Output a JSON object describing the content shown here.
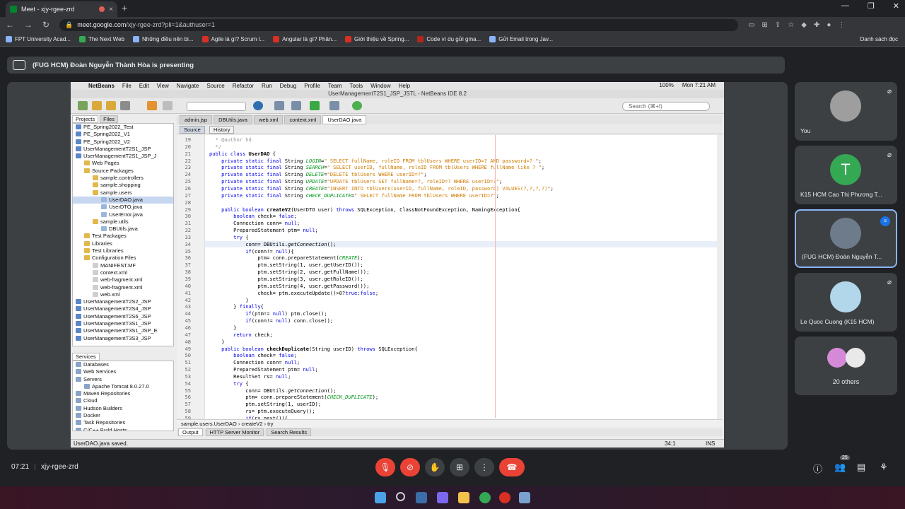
{
  "browser": {
    "tab_title": "Meet - xjy-rgee-zrd",
    "tab_close": "×",
    "new_tab": "+",
    "window_controls": [
      "—",
      "❐",
      "✕"
    ],
    "url_host": "meet.google.com",
    "url_path": "/xjy-rgee-zrd?pli=1&authuser=1",
    "bookmarks": [
      "FPT University Acad...",
      "The Next Web",
      "Những điều nên bi...",
      "Agile là gì? Scrum l...",
      "Angular là gì? Phân...",
      "Giới thiệu về Spring...",
      "Code ví dụ gửi gma...",
      "Gửi Email trong Jav..."
    ],
    "bookmarks_right": "Danh sách đọc"
  },
  "meet": {
    "presenting_text": "(FUG HCM) Đoàn Nguyễn Thành Hòa is presenting",
    "time": "07:21",
    "separator": "|",
    "meeting_code": "xjy-rgee-zrd",
    "people_badge": "25",
    "participants": [
      {
        "name": "You",
        "avatar_color": "#9e9e9e"
      },
      {
        "name": "K15 HCM Cao Thị Phương T...",
        "initial": "T",
        "avatar_color": "#34a853"
      },
      {
        "name": "(FUG HCM) Đoàn Nguyễn T...",
        "avatar_color": "#6d7b8a"
      },
      {
        "name": "Le Quoc Cuong (K15 HCM)",
        "avatar_color": "#b3d7ea"
      },
      {
        "name": "20 others"
      }
    ]
  },
  "netbeans": {
    "menu": [
      "NetBeans",
      "File",
      "Edit",
      "View",
      "Navigate",
      "Source",
      "Refactor",
      "Run",
      "Debug",
      "Profile",
      "Team",
      "Tools",
      "Window",
      "Help"
    ],
    "menu_right": [
      "100%",
      "Mon 7:21 AM"
    ],
    "title": "UserManagementT2S1_JSP_JSTL - NetBeans IDE 8.2",
    "search_placeholder": "Search (⌘+I)",
    "project_tabs": [
      "Projects",
      "Files"
    ],
    "project_tree": [
      {
        "label": "PE_Spring2022_Test",
        "indent": 0,
        "icon": "#5b87c8"
      },
      {
        "label": "PE_Spring2022_V1",
        "indent": 0,
        "icon": "#5b87c8"
      },
      {
        "label": "PE_Spring2022_V2",
        "indent": 0,
        "icon": "#5b87c8"
      },
      {
        "label": "UserManagementT2S1_JSP",
        "indent": 0,
        "icon": "#5b87c8"
      },
      {
        "label": "UserManagementT2S1_JSP_J",
        "indent": 0,
        "icon": "#5b87c8"
      },
      {
        "label": "Web Pages",
        "indent": 1,
        "icon": "#e2b84a"
      },
      {
        "label": "Source Packages",
        "indent": 1,
        "icon": "#e2b84a"
      },
      {
        "label": "sample.controllers",
        "indent": 2,
        "icon": "#e2b84a"
      },
      {
        "label": "sample.shopping",
        "indent": 2,
        "icon": "#e2b84a"
      },
      {
        "label": "sample.users",
        "indent": 2,
        "icon": "#e2b84a"
      },
      {
        "label": "UserDAO.java",
        "indent": 3,
        "icon": "#9bb7de",
        "selected": true
      },
      {
        "label": "UserDTO.java",
        "indent": 3,
        "icon": "#9bb7de"
      },
      {
        "label": "UserError.java",
        "indent": 3,
        "icon": "#9bb7de"
      },
      {
        "label": "sample.utils",
        "indent": 2,
        "icon": "#e2b84a"
      },
      {
        "label": "DBUtils.java",
        "indent": 3,
        "icon": "#9bb7de"
      },
      {
        "label": "Test Packages",
        "indent": 1,
        "icon": "#e2b84a"
      },
      {
        "label": "Libraries",
        "indent": 1,
        "icon": "#e2b84a"
      },
      {
        "label": "Test Libraries",
        "indent": 1,
        "icon": "#e2b84a"
      },
      {
        "label": "Configuration Files",
        "indent": 1,
        "icon": "#e2b84a"
      },
      {
        "label": "MANIFEST.MF",
        "indent": 2,
        "icon": "#cfcfcf"
      },
      {
        "label": "context.xml",
        "indent": 2,
        "icon": "#cfcfcf"
      },
      {
        "label": "web-fragment.xml",
        "indent": 2,
        "icon": "#cfcfcf"
      },
      {
        "label": "web-fragment.xml",
        "indent": 2,
        "icon": "#cfcfcf"
      },
      {
        "label": "web.xml",
        "indent": 2,
        "icon": "#cfcfcf"
      },
      {
        "label": "UserManagementT2S2_JSP",
        "indent": 0,
        "icon": "#5b87c8"
      },
      {
        "label": "UserManagementT2S4_JSP",
        "indent": 0,
        "icon": "#5b87c8"
      },
      {
        "label": "UserManagementT2S6_JSP",
        "indent": 0,
        "icon": "#5b87c8"
      },
      {
        "label": "UserManagementT3S1_JSP",
        "indent": 0,
        "icon": "#5b87c8"
      },
      {
        "label": "UserManagementT3S1_JSP_E",
        "indent": 0,
        "icon": "#5b87c8"
      },
      {
        "label": "UserManagementT3S3_JSP",
        "indent": 0,
        "icon": "#5b87c8"
      }
    ],
    "services_tab": "Services",
    "services_tree": [
      {
        "label": "Databases",
        "indent": 0
      },
      {
        "label": "Web Services",
        "indent": 0
      },
      {
        "label": "Servers",
        "indent": 0
      },
      {
        "label": "Apache Tomcat 8.0.27.0",
        "indent": 1
      },
      {
        "label": "Maven Repositories",
        "indent": 0
      },
      {
        "label": "Cloud",
        "indent": 0
      },
      {
        "label": "Hudson Builders",
        "indent": 0
      },
      {
        "label": "Docker",
        "indent": 0
      },
      {
        "label": "Task Repositories",
        "indent": 0
      },
      {
        "label": "C/C++ Build Hosts",
        "indent": 0
      }
    ],
    "editor_tabs": [
      "admin.jsp",
      "DBUtils.java",
      "web.xml",
      "context.xml",
      "UserDAO.java"
    ],
    "active_tab": "UserDAO.java",
    "source_btn": "Source",
    "history_btn": "History",
    "code_lines": [
      {
        "n": "19",
        "html": "  <span class=\"cm\">* @author hd</span>"
      },
      {
        "n": "20",
        "html": "  <span class=\"cm\">*/</span>"
      },
      {
        "n": "21",
        "html": "<span class=\"kw\">public class</span> <b>UserDAO</b> {"
      },
      {
        "n": "22",
        "html": "    <span class=\"kw\">private static final</span> String <span class=\"fld\">LOGIN</span>=<span class=\"str\">\" SELECT fullName, roleID FROM tblUsers WHERE userID=? AND password=? \"</span>;"
      },
      {
        "n": "23",
        "html": "    <span class=\"kw\">private static final</span> String <span class=\"fld\">SEARCH</span>=<span class=\"str\">\" SELECT userID, fullName, roleID FROM tblUsers WHERE fullName like ? \"</span>;"
      },
      {
        "n": "24",
        "html": "    <span class=\"kw\">private static final</span> String <span class=\"fld\">DELETE</span>=<span class=\"str\">\"DELETE tblUsers WHERE userID=?\"</span>;"
      },
      {
        "n": "25",
        "html": "    <span class=\"kw\">private static final</span> String <span class=\"fld\">UPDATE</span>=<span class=\"str\">\"UPDATE tblUsers SET fullName=?, roleID=? WHERE userID=?\"</span>;"
      },
      {
        "n": "26",
        "html": "    <span class=\"kw\">private static final</span> String <span class=\"fld\">CREATE</span>=<span class=\"str\">\"INSERT INTO tblUsers(userID, fullName, roleID, password) VALUES(?,?,?,?)\"</span>;"
      },
      {
        "n": "27",
        "html": "    <span class=\"kw\">private static final</span> String <span class=\"fld\">CHECK_DUPLICATE</span>=<span class=\"str\">\" SELECT fullName FROM tblUsers WHERE userID=?\"</span>;"
      },
      {
        "n": "28",
        "html": ""
      },
      {
        "n": "29",
        "html": "    <span class=\"kw\">public boolean</span> <b>createV2</b>(UserDTO user) <span class=\"kw\">throws</span> SQLException, ClassNotFoundException, NamingException{"
      },
      {
        "n": "30",
        "html": "        <span class=\"kw\">boolean</span> check= <span class=\"kw\">false</span>;"
      },
      {
        "n": "31",
        "html": "        Connection conn= <span class=\"kw\">null</span>;"
      },
      {
        "n": "32",
        "html": "        PreparedStatement ptm= <span class=\"kw\">null</span>;"
      },
      {
        "n": "33",
        "html": "        <span class=\"kw\">try</span> {"
      },
      {
        "n": "34",
        "html": "            conn= DBUtils.<span class=\"it\">getConnection</span>();",
        "hl": true
      },
      {
        "n": "35",
        "html": "            <span class=\"kw\">if</span>(conn!= <span class=\"kw\">null</span>){"
      },
      {
        "n": "36",
        "html": "                ptm= conn.prepareStatement(<span class=\"fld\">CREATE</span>);"
      },
      {
        "n": "37",
        "html": "                ptm.setString(1, user.getUserID());"
      },
      {
        "n": "38",
        "html": "                ptm.setString(2, user.getFullName());"
      },
      {
        "n": "39",
        "html": "                ptm.setString(3, user.getRoleID());"
      },
      {
        "n": "40",
        "html": "                ptm.setString(4, user.getPassword());"
      },
      {
        "n": "41",
        "html": "                check= ptm.executeUpdate()&gt;0?<span class=\"kw\">true</span>:<span class=\"kw\">false</span>;"
      },
      {
        "n": "42",
        "html": "            }"
      },
      {
        "n": "43",
        "html": "        } <span class=\"kw\">finally</span>{"
      },
      {
        "n": "44",
        "html": "            <span class=\"kw\">if</span>(ptm!= <span class=\"kw\">null</span>) ptm.close();"
      },
      {
        "n": "45",
        "html": "            <span class=\"kw\">if</span>(conn!= <span class=\"kw\">null</span>) conn.close();"
      },
      {
        "n": "46",
        "html": "        }"
      },
      {
        "n": "47",
        "html": "        <span class=\"kw\">return</span> check;"
      },
      {
        "n": "48",
        "html": "    }"
      },
      {
        "n": "49",
        "html": "    <span class=\"kw\">public boolean</span> <b>checkDuplicate</b>(String userID) <span class=\"kw\">throws</span> SQLException{"
      },
      {
        "n": "50",
        "html": "        <span class=\"kw\">boolean</span> check= <span class=\"kw\">false</span>;"
      },
      {
        "n": "51",
        "html": "        Connection conn= <span class=\"kw\">null</span>;"
      },
      {
        "n": "52",
        "html": "        PreparedStatement ptm= <span class=\"kw\">null</span>;"
      },
      {
        "n": "53",
        "html": "        ResultSet rs= <span class=\"kw\">null</span>;"
      },
      {
        "n": "54",
        "html": "        <span class=\"kw\">try</span> {"
      },
      {
        "n": "55",
        "html": "            conn= DBUtils.<span class=\"it\">getConnection</span>();"
      },
      {
        "n": "56",
        "html": "            ptm= conn.prepareStatement(<span class=\"fld\">CHECK_DUPLICATE</span>);"
      },
      {
        "n": "57",
        "html": "            ptm.setString(1, userID);"
      },
      {
        "n": "58",
        "html": "            rs= ptm.executeQuery();"
      },
      {
        "n": "59",
        "html": "            <span class=\"kw\">if</span>(rs.next()){"
      }
    ],
    "breadcrumb": [
      "sample.users.UserDAO",
      "createV2",
      "try"
    ],
    "output_tabs": [
      "Output",
      "HTTP Server Monitor",
      "Search Results"
    ],
    "status_text": "UserDAO.java saved.",
    "cursor_pos": "34:1",
    "insert_mode": "INS"
  }
}
